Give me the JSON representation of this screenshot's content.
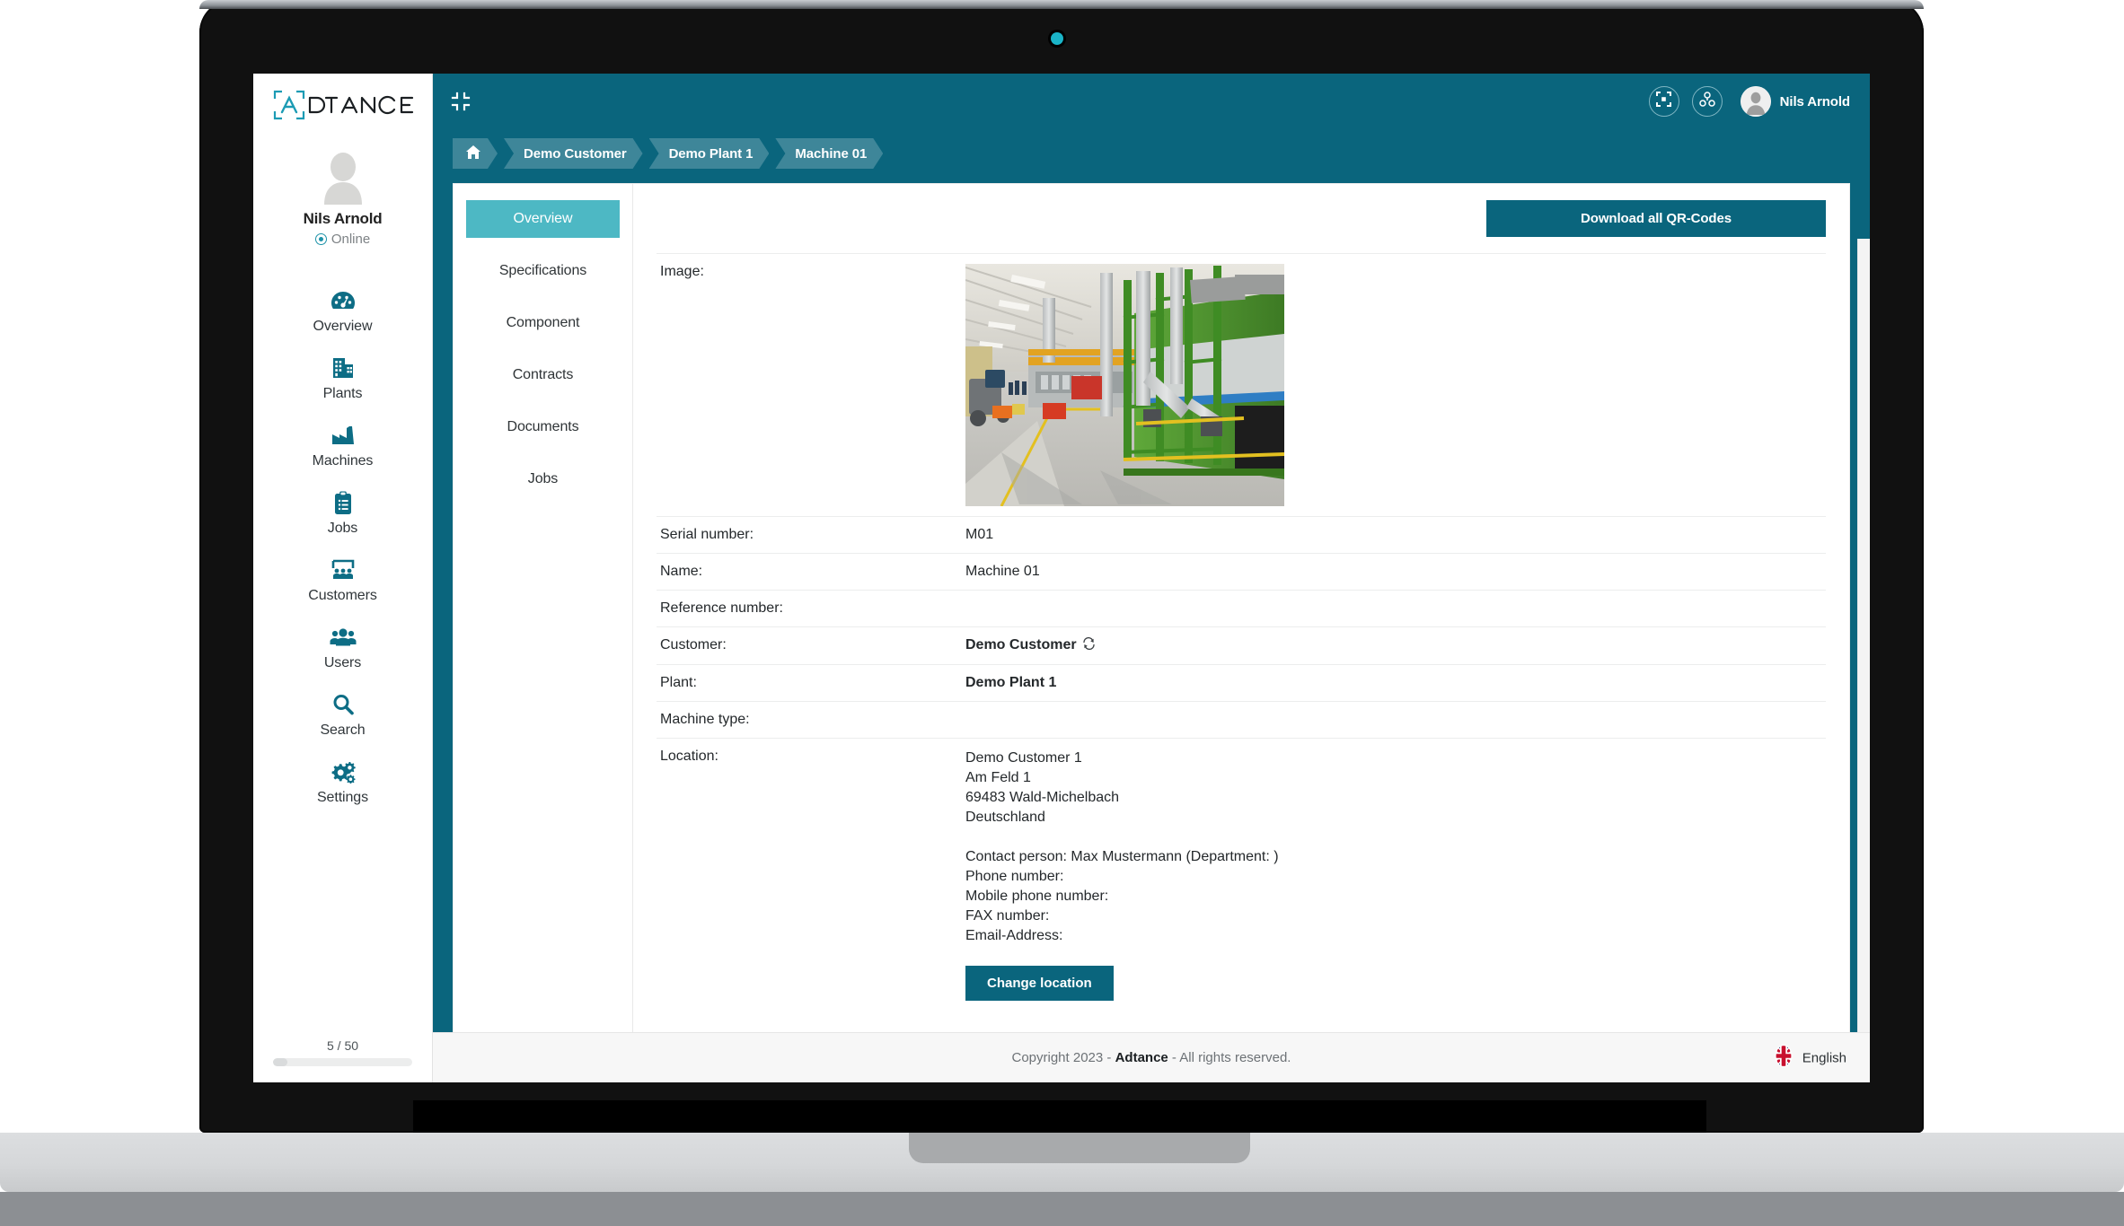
{
  "brand": {
    "logo_text": "DTANCE",
    "accent": "#1c92a8",
    "header_teal": "#0a657d",
    "tab_active_teal": "#4db8c4"
  },
  "sidebar": {
    "profile": {
      "name": "Nils Arnold",
      "status": "Online"
    },
    "items": [
      {
        "label": "Overview",
        "icon": "gauge-icon"
      },
      {
        "label": "Plants",
        "icon": "buildings-icon"
      },
      {
        "label": "Machines",
        "icon": "factory-icon"
      },
      {
        "label": "Jobs",
        "icon": "clipboard-icon"
      },
      {
        "label": "Customers",
        "icon": "presentation-people-icon"
      },
      {
        "label": "Users",
        "icon": "users-icon"
      },
      {
        "label": "Search",
        "icon": "magnifier-icon"
      },
      {
        "label": "Settings",
        "icon": "gears-icon"
      }
    ],
    "quota": "5 / 50"
  },
  "topbar": {
    "collapse_icon": "collapse-icon",
    "fullscreen_icon": "fullscreen-icon",
    "connect_icon": "molecule-icon",
    "user_name": "Nils Arnold"
  },
  "breadcrumb": [
    {
      "label": "",
      "icon": "home-icon"
    },
    {
      "label": "Demo Customer",
      "icon": ""
    },
    {
      "label": "Demo Plant 1",
      "icon": ""
    },
    {
      "label": "Machine 01",
      "icon": ""
    }
  ],
  "tabs": [
    {
      "label": "Overview",
      "active": true
    },
    {
      "label": "Specifications",
      "active": false
    },
    {
      "label": "Component",
      "active": false
    },
    {
      "label": "Contracts",
      "active": false
    },
    {
      "label": "Documents",
      "active": false
    },
    {
      "label": "Jobs",
      "active": false
    }
  ],
  "pane": {
    "download_button": "Download all QR-Codes",
    "image_label": "Image:",
    "rows": [
      {
        "label": "Serial number:",
        "value": "M01",
        "bold": false
      },
      {
        "label": "Name:",
        "value": "Machine 01",
        "bold": false
      },
      {
        "label": "Reference number:",
        "value": "",
        "bold": false
      },
      {
        "label": "Customer:",
        "value": "Demo Customer",
        "bold": true,
        "icon": "sync-icon"
      },
      {
        "label": "Plant:",
        "value": "Demo Plant 1",
        "bold": true
      },
      {
        "label": "Machine type:",
        "value": "",
        "bold": false
      }
    ],
    "location": {
      "label": "Location:",
      "address": [
        "Demo Customer 1",
        "Am Feld 1",
        "69483 Wald-Michelbach",
        "Deutschland"
      ],
      "contact": [
        "Contact person: Max Mustermann (Department: )",
        "Phone number:",
        "Mobile phone number:",
        "FAX number:",
        "Email-Address:"
      ],
      "change_button": "Change location"
    }
  },
  "footer": {
    "copyright_prefix": "Copyright 2023 - ",
    "copyright_brand": "Adtance",
    "copyright_suffix": " - All rights reserved.",
    "language": "English",
    "language_flag": "uk-flag-icon"
  }
}
